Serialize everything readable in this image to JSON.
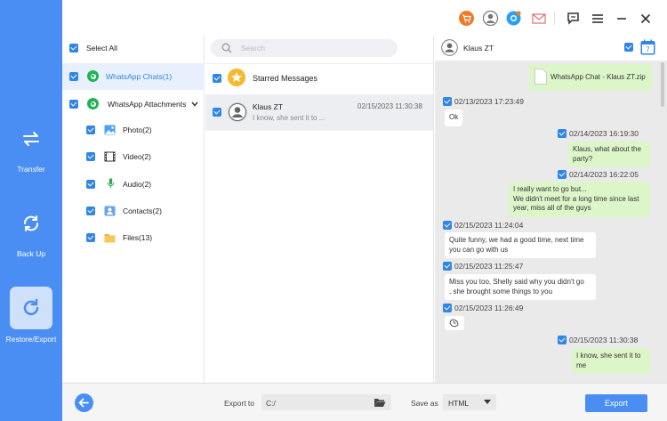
{
  "nav": {
    "transfer": "Transfer",
    "backup": "Back Up",
    "restore": "Restore/Export"
  },
  "col1": {
    "select_all": "Select All",
    "whatsapp_chats": "WhatsApp Chats(1)",
    "whatsapp_attachments": "WhatsApp Attachments",
    "attachments": [
      {
        "label": "Photo(2)",
        "icon": "photo-icon"
      },
      {
        "label": "Video(2)",
        "icon": "video-icon"
      },
      {
        "label": "Audio(2)",
        "icon": "audio-icon"
      },
      {
        "label": "Contacts(2)",
        "icon": "contacts-icon"
      },
      {
        "label": "Files(13)",
        "icon": "folder-icon"
      }
    ]
  },
  "col2": {
    "search_placeholder": "Search",
    "starred": "Starred Messages",
    "chat_name": "Klaus ZT",
    "chat_preview": "I know, she sent it to ...",
    "chat_time": "02/15/2023 11:30:38"
  },
  "chat": {
    "contact": "Klaus ZT",
    "calendar_day": "7",
    "file_name": "WhatsApp Chat - Klaus ZT.zip",
    "messages": [
      {
        "time": "02/13/2023 17:23:49",
        "lines": [
          "Ok"
        ]
      },
      {
        "time": "02/14/2023 16:19:30",
        "lines": [
          "Klaus, what about the",
          "party?"
        ]
      },
      {
        "time": "02/14/2023 16:22:05",
        "lines": [
          "I really want to go but...",
          "We didn't meet for a long time since last",
          "year, miss all of the guys"
        ]
      },
      {
        "time": "02/15/2023 11:24:04",
        "lines": [
          "Quite funny, we had a good time, next time",
          "you can go with us"
        ]
      },
      {
        "time": "02/15/2023 11:25:47",
        "lines": [
          "Miss you too, Shelly said why you didn't go",
          ", she brought some things to you"
        ]
      },
      {
        "time": "02/15/2023 11:26:49",
        "lines": [
          ""
        ]
      },
      {
        "time": "02/15/2023 11:30:38",
        "lines": [
          "I know, she sent it to",
          "me"
        ]
      }
    ]
  },
  "bottom": {
    "export_to_label": "Export to",
    "export_path": "C:/",
    "save_as_label": "Save as",
    "save_as_value": "HTML",
    "export_button": "Export"
  },
  "colors": {
    "accent": "#4a8ef4",
    "checkbox": "#2f86e6",
    "outgoing": "#dcf6c9"
  }
}
